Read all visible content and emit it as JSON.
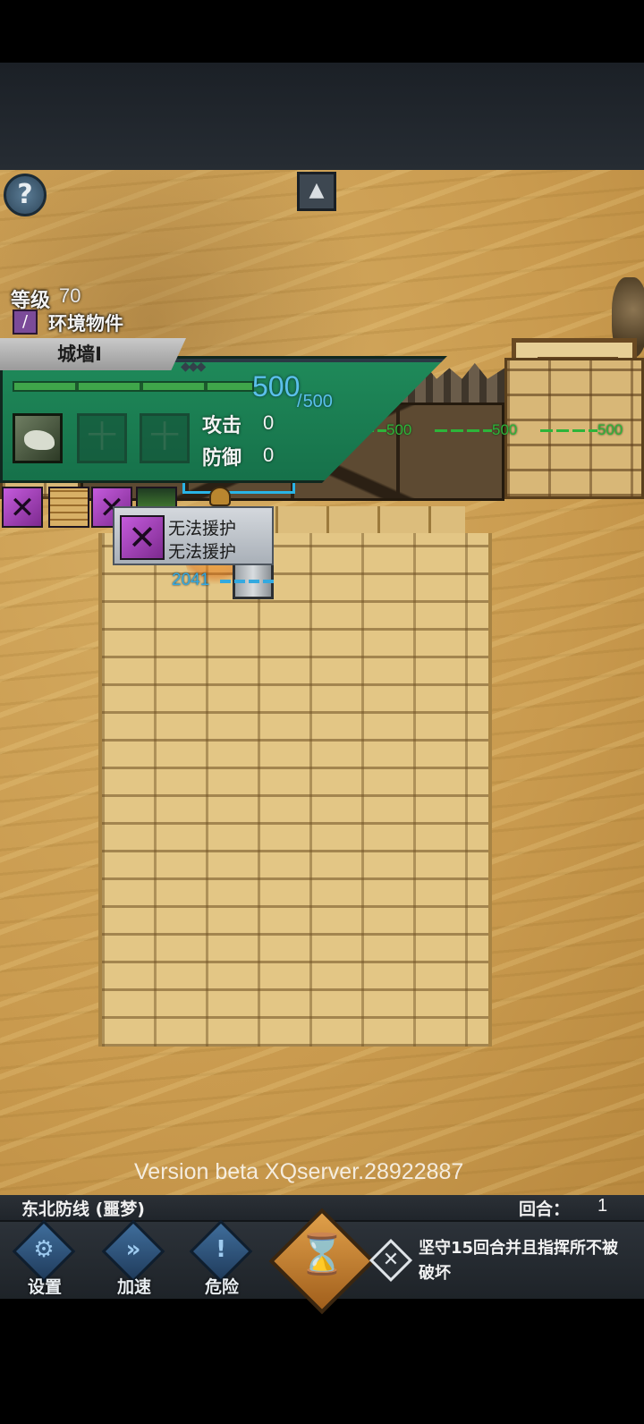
{
  "top_bar": {
    "help_icon": "question-mark-icon",
    "help_glyph": "?",
    "collapse_icon": "collapse-panel-icon",
    "collapse_glyph": "▲"
  },
  "info_panel": {
    "level_label": "等级",
    "level_value": "70",
    "type_icon": "wrench-icon",
    "type_glyph": "/",
    "type_label": "环境物件",
    "object_name": "城墙I",
    "pips": "◆◆◆",
    "hp_current": "500",
    "hp_max": "500",
    "hp_fraction": 1.0,
    "skill_icon": "goat-skill-icon",
    "empty_slot_glyph": "十",
    "attack_label": "攻击",
    "attack_value": "0",
    "defense_label": "防御",
    "defense_value": "0",
    "colors": {
      "panel": "#1f8a5a",
      "hp_text": "#5bc0eb"
    }
  },
  "buffs": [
    {
      "icon": "crossed-swords-icon"
    },
    {
      "icon": "wall-icon"
    },
    {
      "icon": "crossed-swords-icon"
    },
    {
      "icon": "grass-icon"
    }
  ],
  "tooltip": {
    "icon": "crossed-swords-icon",
    "line1": "无法援护",
    "line2": "无法援护"
  },
  "field": {
    "wall_hp": [
      "500",
      "500",
      "500",
      "500",
      "500",
      "500"
    ],
    "hero_hp": "2041",
    "colors": {
      "wall_hp": "#2db43a",
      "hero_hp": "#33a9e0",
      "target": "#29b4e6"
    }
  },
  "version": "Version beta XQserver.28922887",
  "status": {
    "stage_name": "东北防线 (噩梦)",
    "round_label": "回合：",
    "round_value": "1"
  },
  "controls": [
    {
      "icon": "gears-icon",
      "glyph": "⚙",
      "label": "设置"
    },
    {
      "icon": "fast-forward-icon",
      "glyph": "»",
      "label": "加速"
    },
    {
      "icon": "exclamation-icon",
      "glyph": "!",
      "label": "危险"
    }
  ],
  "end_turn": {
    "icon": "hourglass-icon",
    "glyph": "⌛"
  },
  "objective": {
    "icon": "crossed-tools-icon",
    "glyph": "✕",
    "text": "坚守15回合并且指挥所不被破坏"
  }
}
